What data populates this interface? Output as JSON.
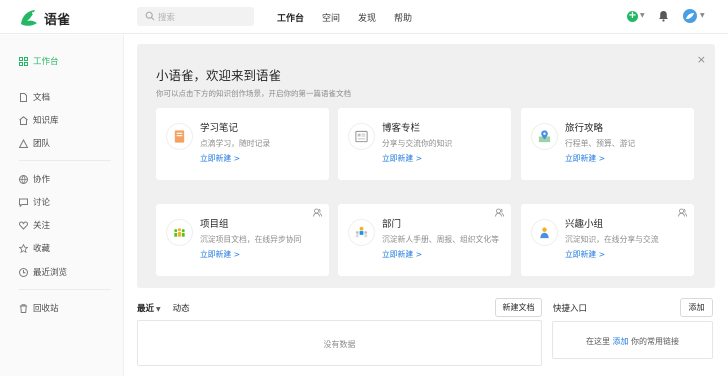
{
  "brand": {
    "name": "语雀"
  },
  "search": {
    "placeholder": "搜索"
  },
  "topnav": [
    "工作台",
    "空间",
    "发现",
    "帮助"
  ],
  "sidebar": {
    "items": [
      {
        "label": "工作台",
        "icon": "grid-icon",
        "active": true
      },
      {
        "label": "文档",
        "icon": "document-icon"
      },
      {
        "label": "知识库",
        "icon": "knowledge-icon"
      },
      {
        "label": "团队",
        "icon": "team-icon"
      },
      {
        "label": "协作",
        "icon": "globe-icon"
      },
      {
        "label": "讨论",
        "icon": "chat-icon"
      },
      {
        "label": "关注",
        "icon": "heart-icon"
      },
      {
        "label": "收藏",
        "icon": "star-icon"
      },
      {
        "label": "最近浏览",
        "icon": "clock-icon"
      },
      {
        "label": "回收站",
        "icon": "trash-icon"
      }
    ]
  },
  "welcome": {
    "title": "小语雀，欢迎来到语雀",
    "subtitle": "你可以点击下方的知识创作场景，开启你的第一篇语雀文档",
    "close": "×",
    "cards": [
      {
        "title": "学习笔记",
        "desc": "点滴学习，随时记录",
        "link": "立即新建 >"
      },
      {
        "title": "博客专栏",
        "desc": "分享与交流你的知识",
        "link": "立即新建 >"
      },
      {
        "title": "旅行攻略",
        "desc": "行程单、预算、游记",
        "link": "立即新建 >"
      },
      {
        "title": "项目组",
        "desc": "沉淀项目文档，在线异步协同",
        "link": "立即新建 >"
      },
      {
        "title": "部门",
        "desc": "沉淀新人手册、周报、组织文化等",
        "link": "立即新建 >"
      },
      {
        "title": "兴趣小组",
        "desc": "沉淀知识，在线分享与交流",
        "link": "立即新建 >"
      }
    ]
  },
  "recent": {
    "tabs": [
      "最近",
      "动态"
    ],
    "new_doc": "新建文档",
    "empty": "没有数据"
  },
  "quick": {
    "title": "快捷入口",
    "add": "添加",
    "msg_pre": "在这里",
    "msg_link": "添加",
    "msg_post": "你的常用链接"
  },
  "colors": {
    "accent": "#25b864",
    "link": "#1f7be0"
  }
}
